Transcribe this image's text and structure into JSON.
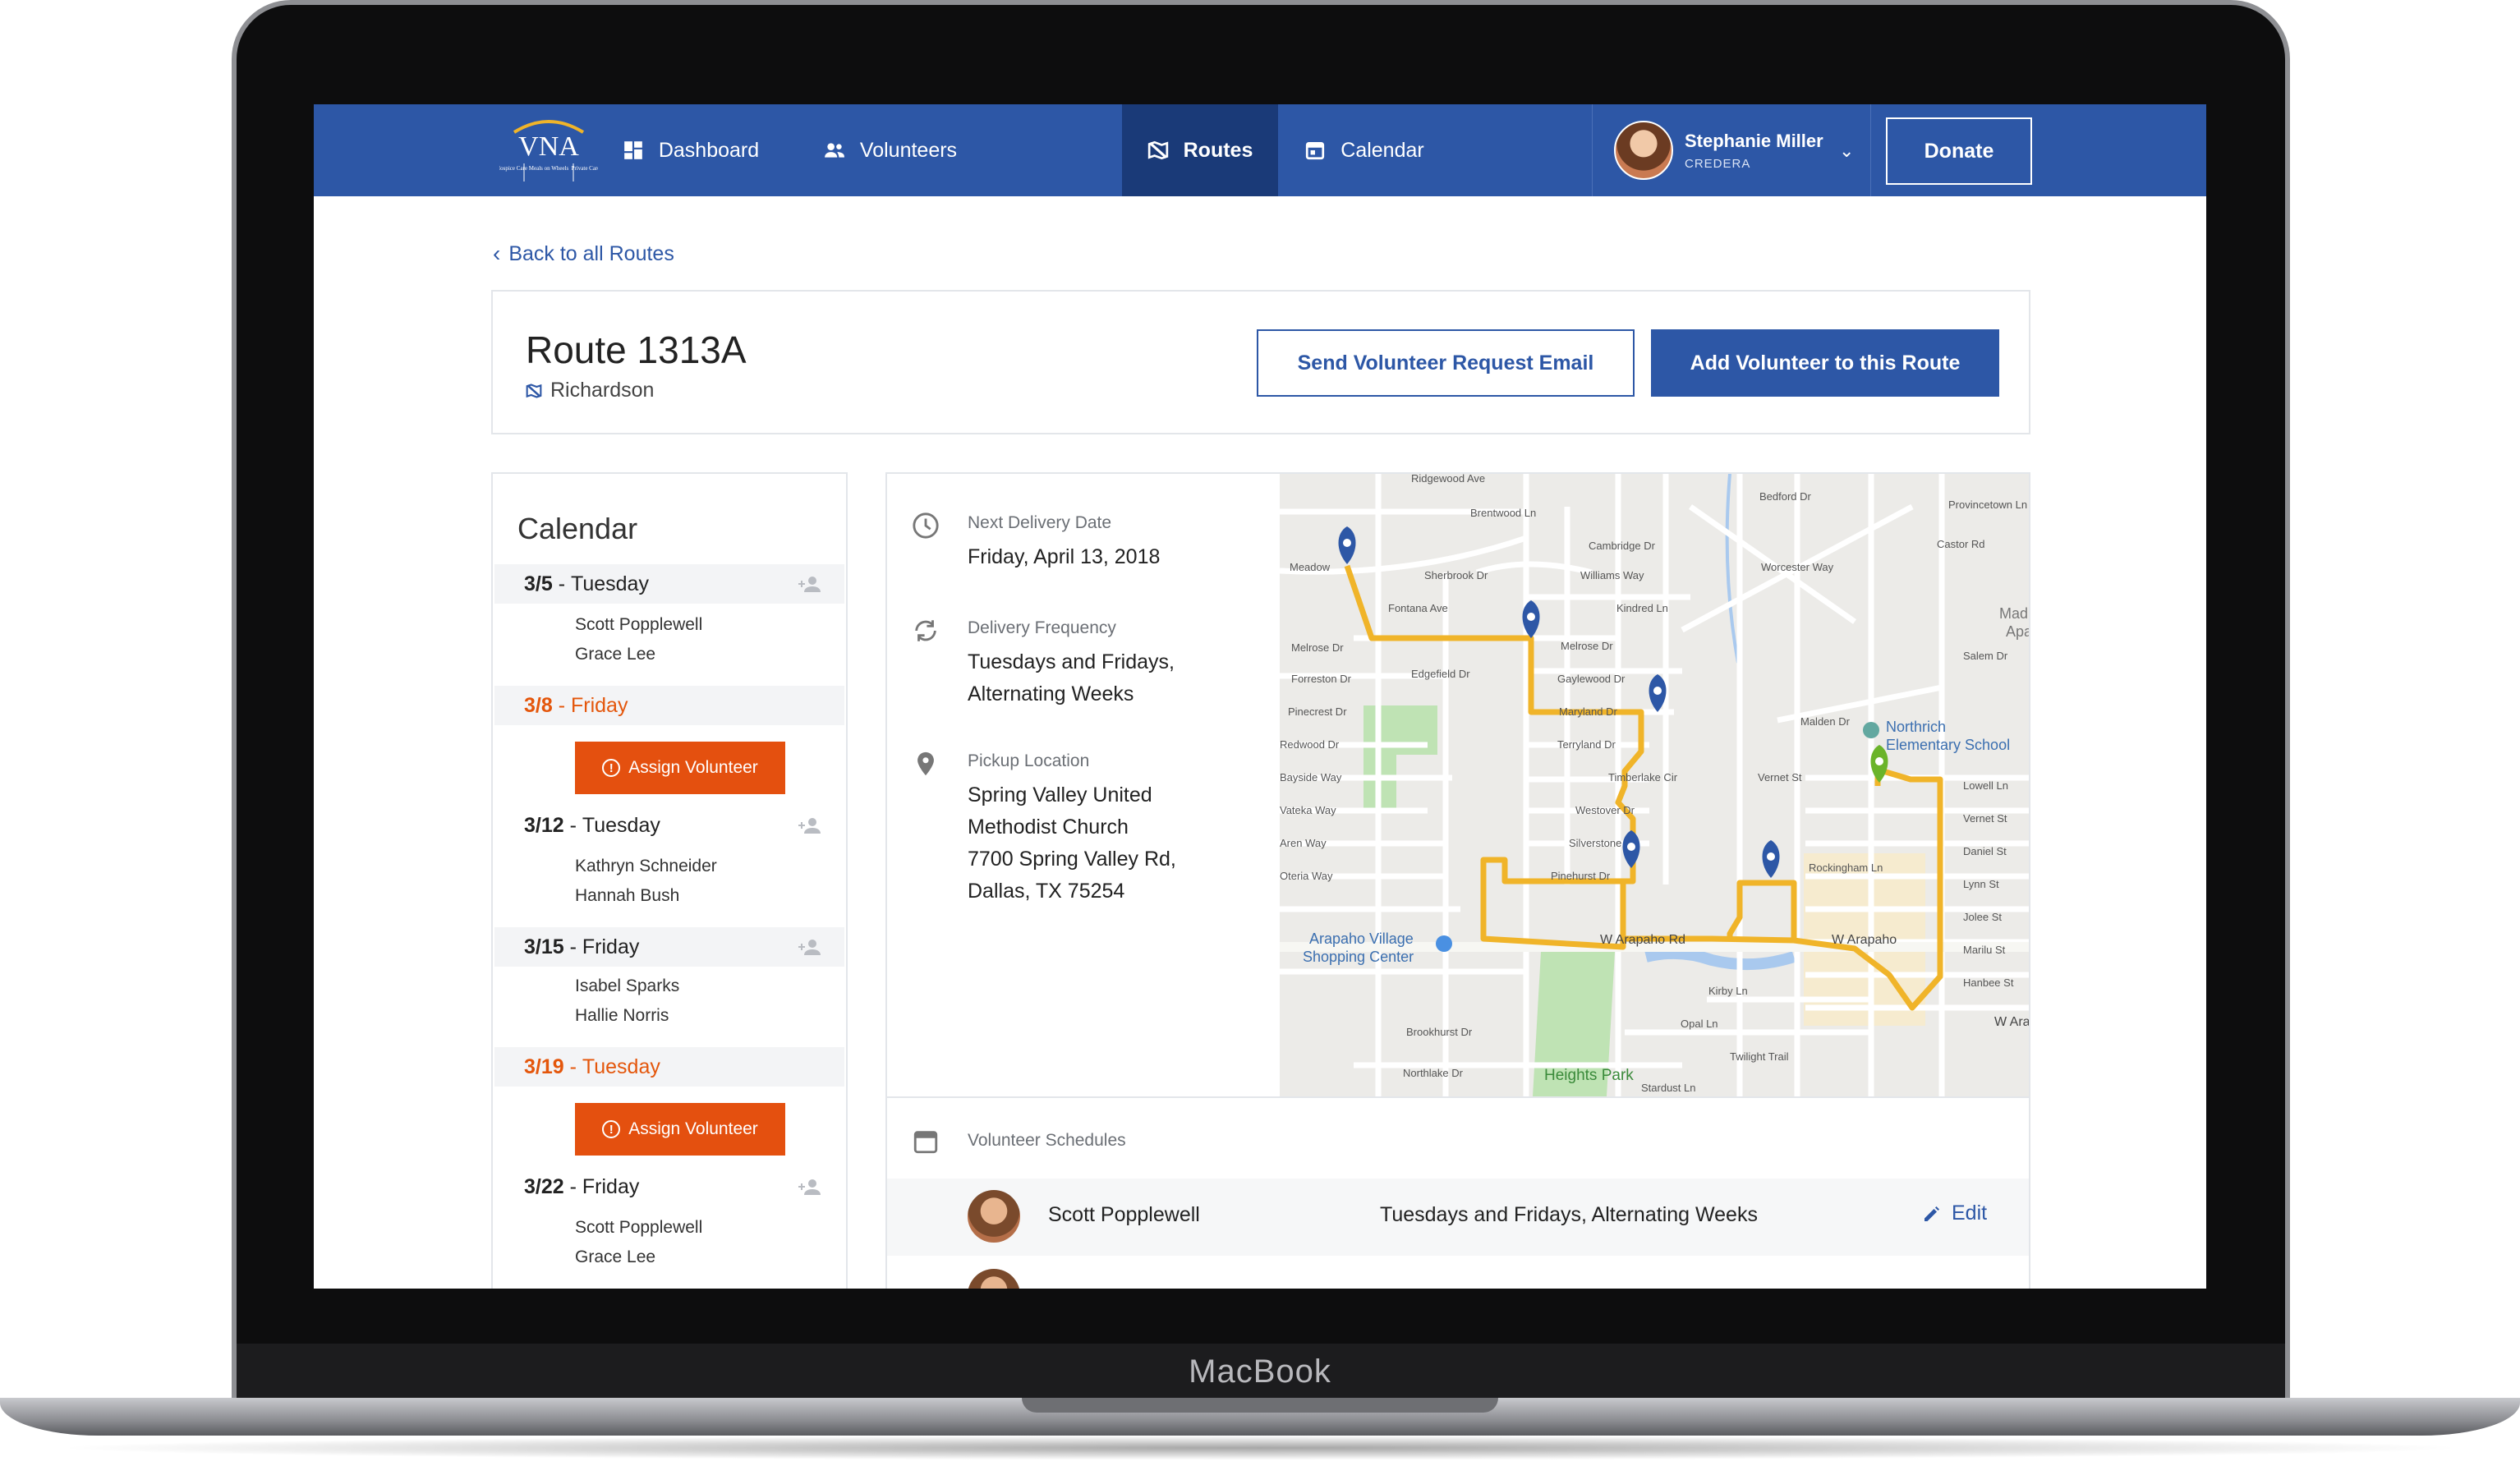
{
  "device": {
    "brand_label": "MacBook"
  },
  "nav": {
    "logo_text": "VNA",
    "logo_subtext": [
      "Hospice Care",
      "Meals on Wheels",
      "Private Care"
    ],
    "items": [
      {
        "label": "Dashboard",
        "icon": "dashboard-icon"
      },
      {
        "label": "Volunteers",
        "icon": "people-icon"
      },
      {
        "label": "Routes",
        "icon": "map-icon",
        "active": true
      },
      {
        "label": "Calendar",
        "icon": "calendar-icon"
      }
    ],
    "user": {
      "name": "Stephanie Miller",
      "org": "CREDERA"
    },
    "donate_label": "Donate"
  },
  "back_link": "Back to all Routes",
  "route": {
    "title": "Route 1313A",
    "area": "Richardson",
    "send_email_label": "Send Volunteer Request Email",
    "add_volunteer_label": "Add Volunteer to this Route"
  },
  "calendar": {
    "title": "Calendar",
    "assign_label": "Assign Volunteer",
    "entries": [
      {
        "date": "3/5",
        "day": "Tuesday",
        "names": [
          "Scott Popplewell",
          "Grace Lee"
        ],
        "unassigned": false
      },
      {
        "date": "3/8",
        "day": "Friday",
        "names": [],
        "unassigned": true
      },
      {
        "date": "3/12",
        "day": "Tuesday",
        "names": [
          "Kathryn Schneider",
          "Hannah Bush"
        ],
        "unassigned": false
      },
      {
        "date": "3/15",
        "day": "Friday",
        "names": [
          "Isabel Sparks",
          "Hallie Norris"
        ],
        "unassigned": false
      },
      {
        "date": "3/19",
        "day": "Tuesday",
        "names": [],
        "unassigned": true
      },
      {
        "date": "3/22",
        "day": "Friday",
        "names": [
          "Scott Popplewell",
          "Grace Lee"
        ],
        "unassigned": false
      }
    ]
  },
  "details": {
    "next_delivery_label": "Next Delivery Date",
    "next_delivery_value": "Friday, April 13, 2018",
    "frequency_label": "Delivery Frequency",
    "frequency_value": [
      "Tuesdays and Fridays,",
      "Alternating Weeks"
    ],
    "pickup_label": "Pickup Location",
    "pickup_value": [
      "Spring Valley United",
      "Methodist Church",
      "7700 Spring Valley Rd,",
      "Dallas, TX 75254"
    ]
  },
  "map": {
    "labels": {
      "northrich": [
        "Northrich",
        "Elementary School"
      ],
      "arapaho_village": [
        "Arapaho Village",
        "Shopping Center"
      ],
      "heights_park": "Heights Park",
      "w_arapaho_rd": "W Arapaho Rd",
      "w_arapaho": "W Arapaho",
      "w_ara": "W Ara",
      "madis": [
        "Madis",
        "Apa"
      ]
    },
    "streets": [
      "Meadow",
      "Fontana Ave",
      "Edgefield Dr",
      "Melrose Dr",
      "Forreston Dr",
      "Pinecrest Dr",
      "Redwood Dr",
      "Bayside Way",
      "Vateka Way",
      "Aren Way",
      "Oteria Way",
      "Sherbrook Dr",
      "Williams Way",
      "Kindred Ln",
      "Gaylewood Dr",
      "Maryland Dr",
      "Terryland Dr",
      "Timberlake Cir",
      "Westover Dr",
      "Silverstone",
      "Pinehurst Dr",
      "Melrose Dr",
      "Cambridge Dr",
      "Worcester Way",
      "Bedford Dr",
      "Provincetown Ln",
      "Malden Dr",
      "Vernet St",
      "Lowell Ln",
      "Vernet St",
      "Daniel St",
      "Lynn St",
      "Jolee St",
      "Marilu St",
      "Hanbee St",
      "Rockingham Ln",
      "Kirby Ln",
      "Opal Ln",
      "Twilight Trail",
      "Brookhurst Dr",
      "Northlake Dr",
      "Stardust Ln",
      "Brentwood Ln",
      "Ridgewood Ave",
      "Salem Dr",
      "Castor Rd"
    ],
    "colors": {
      "route": "#f0b429",
      "pin": "#2d57a6",
      "pickup_pin": "#6bb42a",
      "park": "#bfe3b4",
      "water": "#a9c9ee"
    }
  },
  "schedules": {
    "title": "Volunteer Schedules",
    "rows": [
      {
        "name": "Scott Popplewell",
        "frequency": "Tuesdays and Fridays, Alternating Weeks",
        "edit_label": "Edit"
      }
    ]
  }
}
